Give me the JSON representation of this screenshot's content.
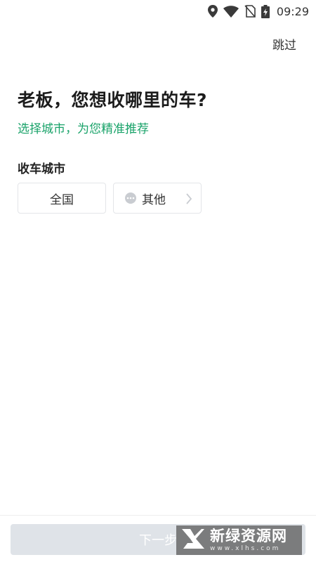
{
  "status_bar": {
    "time": "09:29",
    "icons": [
      "location-icon",
      "wifi-icon",
      "no-sim-icon",
      "battery-charging-icon"
    ]
  },
  "header": {
    "skip_label": "跳过"
  },
  "main": {
    "title": "老板，您想收哪里的车?",
    "subtitle": "选择城市，为您精准推荐",
    "section_label": "收车城市",
    "options": [
      {
        "label": "全国"
      },
      {
        "label": "其他",
        "icon": "more-dots-icon"
      }
    ]
  },
  "footer": {
    "next_label": "下一步"
  },
  "watermark": {
    "title": "新绿资源网",
    "url": "www.xlhs.com"
  },
  "colors": {
    "accent": "#1aa36a",
    "button_disabled": "#dfe3e8"
  }
}
